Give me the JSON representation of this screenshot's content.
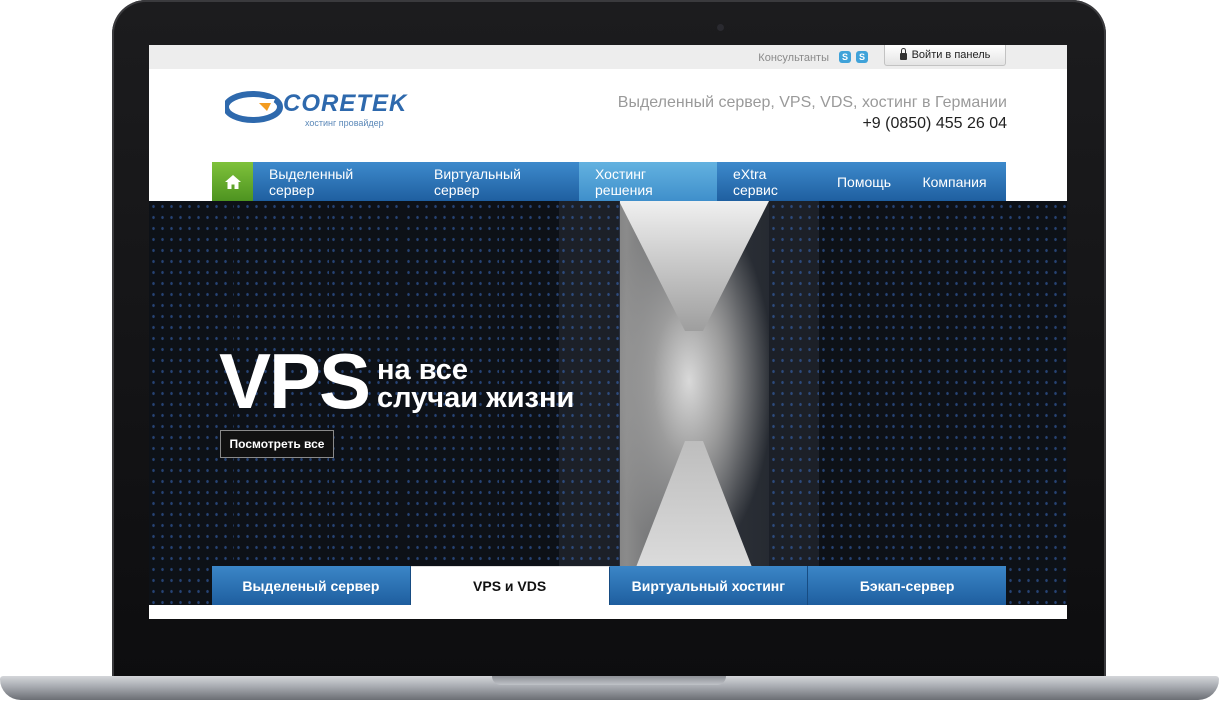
{
  "topbar": {
    "consultants_label": "Консультанты",
    "skype_icon": "skype-icon",
    "login_label": "Войти в панель",
    "login_icon": "lock-icon"
  },
  "header": {
    "logo_text": "CORETEK",
    "logo_subtitle": "хостинг провайдер",
    "tagline": "Выделенный сервер, VPS, VDS, хостинг в Германии",
    "phone": "+9 (0850) 455 26 04"
  },
  "nav": {
    "home_icon": "home-icon",
    "items": [
      {
        "label": "Выделенный сервер"
      },
      {
        "label": "Виртуальный сервер"
      },
      {
        "label": "Хостинг решения",
        "active": true
      },
      {
        "label": "eXtra сервис"
      },
      {
        "label": "Помощь"
      },
      {
        "label": "Компания"
      }
    ]
  },
  "hero": {
    "title_big": "VPS",
    "title_line1": "на все",
    "title_line2": "случаи жизни",
    "button_label": "Посмотреть все"
  },
  "tabs": [
    {
      "label": "Выделеный сервер"
    },
    {
      "label": "VPS и VDS",
      "active": true
    },
    {
      "label": "Виртуальный хостинг"
    },
    {
      "label": "Бэкап-сервер"
    }
  ],
  "colors": {
    "nav_blue": "#2a6fb3",
    "nav_active": "#4f9fd6",
    "home_green": "#6cae2e",
    "logo_blue": "#2e69ad",
    "logo_orange": "#f39b1f"
  }
}
